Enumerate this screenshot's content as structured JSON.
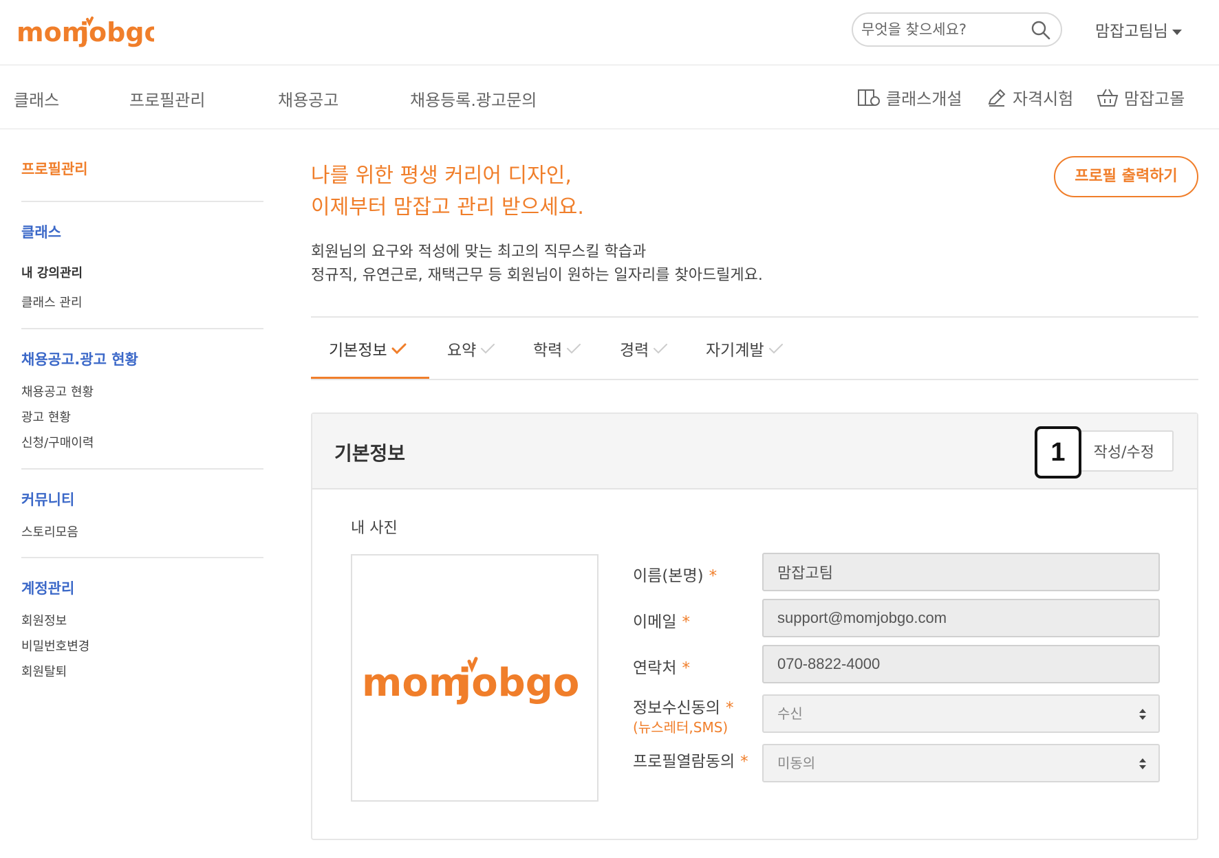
{
  "brand": {
    "logo_text": "momjobgo",
    "accent_color": "#f07e2a",
    "link_color": "#3b68c8"
  },
  "header": {
    "search_placeholder": "무엇을 찾으세요?",
    "search_icon": "search-icon",
    "user_name": "맘잡고팀님"
  },
  "nav": {
    "items": [
      "클래스",
      "프로필관리",
      "채용공고",
      "채용등록.광고문의"
    ],
    "right_items": [
      {
        "label": "클래스개설",
        "icon": "class-open-icon"
      },
      {
        "label": "자격시험",
        "icon": "pencil-icon"
      },
      {
        "label": "맘잡고몰",
        "icon": "basket-icon"
      }
    ]
  },
  "sidebar": {
    "profile_heading": "프로필관리",
    "sections": [
      {
        "heading": "클래스",
        "items": [
          "내 강의관리",
          "클래스 관리"
        ]
      },
      {
        "heading": "채용공고.광고 현황",
        "items": [
          "채용공고 현황",
          "광고 현황",
          "신청/구매이력"
        ]
      },
      {
        "heading": "커뮤니티",
        "items": [
          "스토리모음"
        ]
      },
      {
        "heading": "계정관리",
        "items": [
          "회원정보",
          "비밀번호변경",
          "회원탈퇴"
        ]
      }
    ]
  },
  "hero": {
    "title_line1": "나를 위한 평생 커리어 디자인,",
    "title_line2": "이제부터 맘잡고 관리 받으세요.",
    "desc_line1": "회원님의 요구와 적성에 맞는 최고의 직무스킬 학습과",
    "desc_line2": "정규직, 유연근로, 재택근무 등 회원님이 원하는 일자리를 찾아드릴게요.",
    "print_button": "프로필 출력하기"
  },
  "tabs": [
    {
      "label": "기본정보",
      "active": true
    },
    {
      "label": "요약",
      "active": false
    },
    {
      "label": "학력",
      "active": false
    },
    {
      "label": "경력",
      "active": false
    },
    {
      "label": "자기계발",
      "active": false
    }
  ],
  "panel": {
    "title": "기본정보",
    "edit_button": "작성/수정",
    "callout_number": "1",
    "photo_label": "내 사진",
    "fields": {
      "name": {
        "label": "이름(본명)",
        "required": "*",
        "value": "맘잡고팀"
      },
      "email": {
        "label": "이메일",
        "required": "*",
        "value": "support@momjobgo.com"
      },
      "phone": {
        "label": "연락처",
        "required": "*",
        "value": "070-8822-4000"
      },
      "consent": {
        "label": "정보수신동의",
        "required": "*",
        "sub_label": "(뉴스레터,SMS)",
        "value": "수신"
      },
      "profile_view": {
        "label": "프로필열람동의",
        "required": "*",
        "value": "미동의"
      }
    }
  }
}
